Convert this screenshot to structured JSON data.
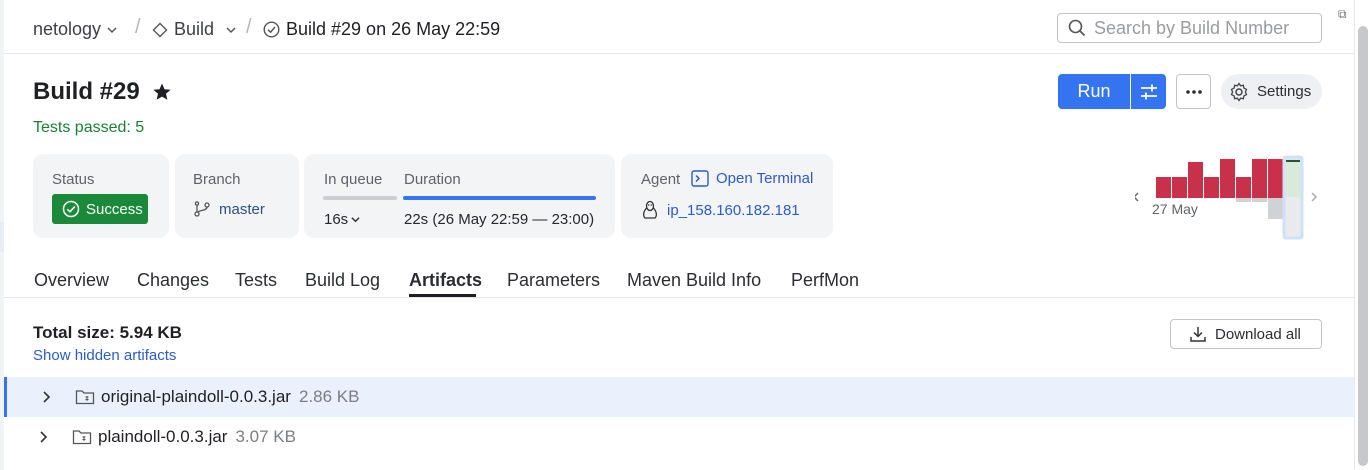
{
  "breadcrumb": {
    "project": "netology",
    "config": "Build",
    "build": "Build #29 on 26 May 22:59"
  },
  "search": {
    "placeholder": "Search by Build Number"
  },
  "header": {
    "title": "Build #29",
    "subtitle": "Tests passed: 5",
    "run_label": "Run",
    "settings_label": "Settings"
  },
  "cards": {
    "status_label": "Status",
    "status_value": "Success",
    "branch_label": "Branch",
    "branch_value": "master",
    "queue_label": "In queue",
    "queue_value": "16s",
    "duration_label": "Duration",
    "duration_value": "22s (26 May 22:59 — 23:00)",
    "duration_progress": 1.0,
    "agent_label": "Agent",
    "agent_link": "Open Terminal",
    "agent_value": "ip_158.160.182.181"
  },
  "mini_chart": {
    "date_label": "27 May",
    "colors": {
      "failed": "#c9304a",
      "success": "#d0d2d6",
      "selected": "#cfe0fb"
    }
  },
  "tabs": [
    {
      "label": "Overview"
    },
    {
      "label": "Changes"
    },
    {
      "label": "Tests"
    },
    {
      "label": "Build Log"
    },
    {
      "label": "Artifacts",
      "active": true
    },
    {
      "label": "Parameters"
    },
    {
      "label": "Maven Build Info"
    },
    {
      "label": "PerfMon"
    }
  ],
  "artifacts": {
    "total_size": "Total size: 5.94 KB",
    "hidden_link": "Show hidden artifacts",
    "download_all": "Download all",
    "items": [
      {
        "name": "original-plaindoll-0.0.3.jar",
        "size": "2.86 KB",
        "selected": true
      },
      {
        "name": "plaindoll-0.0.3.jar",
        "size": "3.07 KB",
        "selected": false
      }
    ]
  }
}
